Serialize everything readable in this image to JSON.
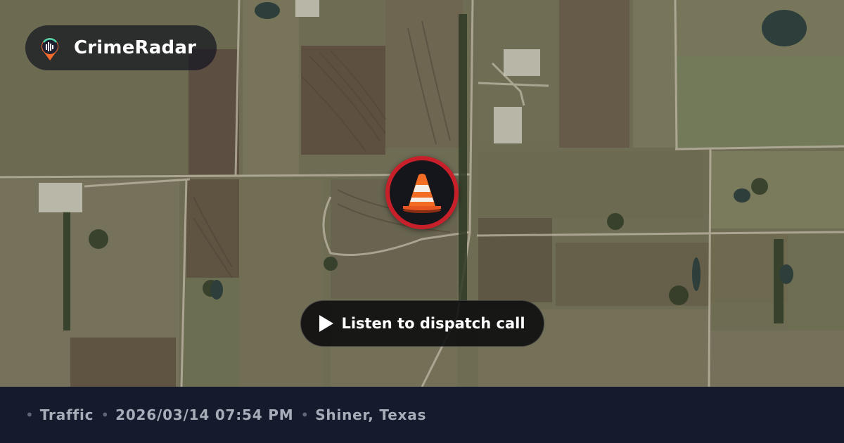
{
  "brand": {
    "name": "CrimeRadar",
    "logo_icon": "radar-pin-icon"
  },
  "incident": {
    "icon": "traffic-cone-icon",
    "ring_color": "#c8202a"
  },
  "listen_button": {
    "label": "Listen to dispatch call",
    "icon": "play-icon"
  },
  "footer": {
    "category": "Traffic",
    "datetime": "2026/03/14 07:54 PM",
    "location": "Shiner, Texas",
    "separator": "•"
  },
  "colors": {
    "footer_bg": "#151b2c",
    "footer_text": "#a7adb9",
    "marker_ring": "#c8202a"
  }
}
